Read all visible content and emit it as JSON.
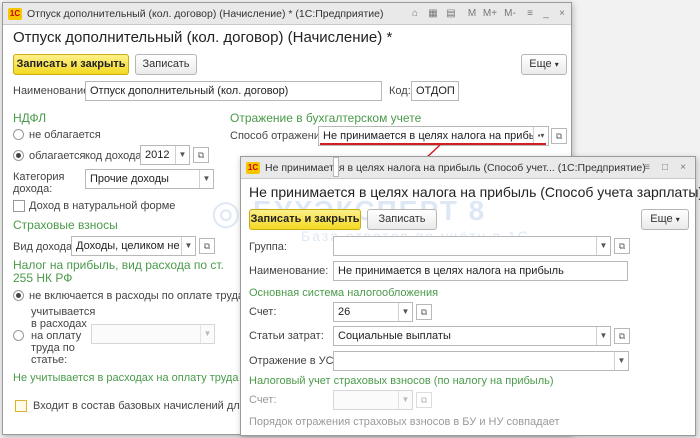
{
  "back": {
    "title_bar": "Отпуск дополнительный (кол. договор) (Начисление) * (1С:Предприятие)",
    "heading": "Отпуск дополнительный (кол. договор) (Начисление) *",
    "buttons": {
      "save_close": "Записать и закрыть",
      "save": "Записать",
      "more": "Еще"
    },
    "name_label": "Наименование:",
    "name_value": "Отпуск дополнительный (кол. договор)",
    "code_label": "Код:",
    "code_value": "ОТДОП",
    "ndfl": {
      "title": "НДФЛ",
      "not_taxed": "не облагается",
      "taxed": "облагается",
      "income_code_label": "код дохода:",
      "income_code_value": "2012",
      "income_category_label": "Категория дохода:",
      "income_category_value": "Прочие доходы",
      "in_kind": "Доход в натуральной форме"
    },
    "insurance": {
      "title": "Страховые взносы",
      "income_type_label": "Вид дохода:",
      "income_type_value": "Доходы, целиком не обл"
    },
    "profit_tax": {
      "title": "Налог на прибыль, вид расхода по ст. 255 НК РФ",
      "not_included": "не включается в расходы по оплате труда",
      "included": "учитывается в расходах на оплату труда по статье:",
      "note": "Не учитывается в расходах на оплату труда"
    },
    "accounting": {
      "title": "Отражение в бухгалтерском учете",
      "method_label": "Способ отражения:",
      "method_value": "Не принимается в целях налога на прибыль"
    },
    "base_accruals": "Входит в состав базовых начислений для расче"
  },
  "front": {
    "title_bar": "Не принимается в целях налога на прибыль (Способ учет... (1С:Предприятие)",
    "heading": "Не принимается в целях налога на прибыль (Способ учета зарплаты)",
    "buttons": {
      "save_close": "Записать и закрыть",
      "save": "Записать",
      "more": "Еще"
    },
    "group_label": "Группа:",
    "name_label": "Наименование:",
    "name_value": "Не принимается в целях налога на прибыль",
    "main_tax_title": "Основная система налогообложения",
    "account_label": "Счет:",
    "account_value": "26",
    "cost_items_label": "Статьи затрат:",
    "cost_items_value": "Социальные выплаты",
    "usn_label": "Отражение в УСН:",
    "insurance_title": "Налоговый учет страховых взносов (по налогу на прибыль)",
    "account2_label": "Счет:",
    "match_note": "Порядок отражения страховых взносов в БУ и НУ совпадает"
  },
  "watermark": {
    "line1": "БУХЭКСПЕРТ 8",
    "line2": "База ответов по учёту в 1С"
  },
  "icons": {
    "dropdown": "chevron-down-icon",
    "open": "open-form-icon",
    "close": "close-icon"
  }
}
